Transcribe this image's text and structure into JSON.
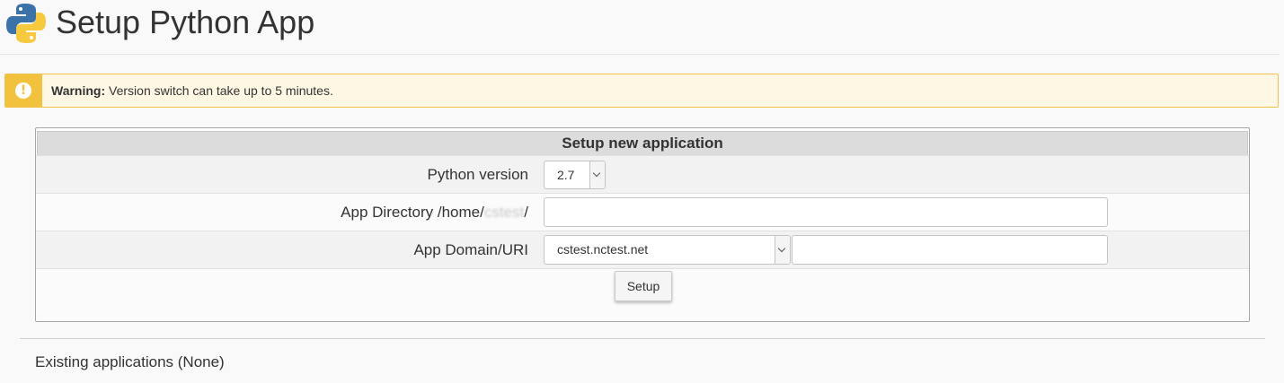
{
  "header": {
    "title": "Setup Python App",
    "logo_icon": "python-logo-icon"
  },
  "warning": {
    "label": "Warning:",
    "message": "Version switch can take up to 5 minutes.",
    "icon": "exclamation-icon",
    "accent_color": "#f2c23e"
  },
  "form": {
    "title": "Setup new application",
    "python_version": {
      "label": "Python version",
      "selected": "2.7"
    },
    "app_directory": {
      "label_prefix": "App Directory /home/",
      "label_user": "cstest",
      "label_suffix": "/",
      "value": ""
    },
    "app_domain": {
      "label": "App Domain/URI",
      "selected_domain": "cstest.nctest.net",
      "uri_value": ""
    },
    "setup_button": "Setup"
  },
  "existing": {
    "text": "Existing applications (None)"
  }
}
